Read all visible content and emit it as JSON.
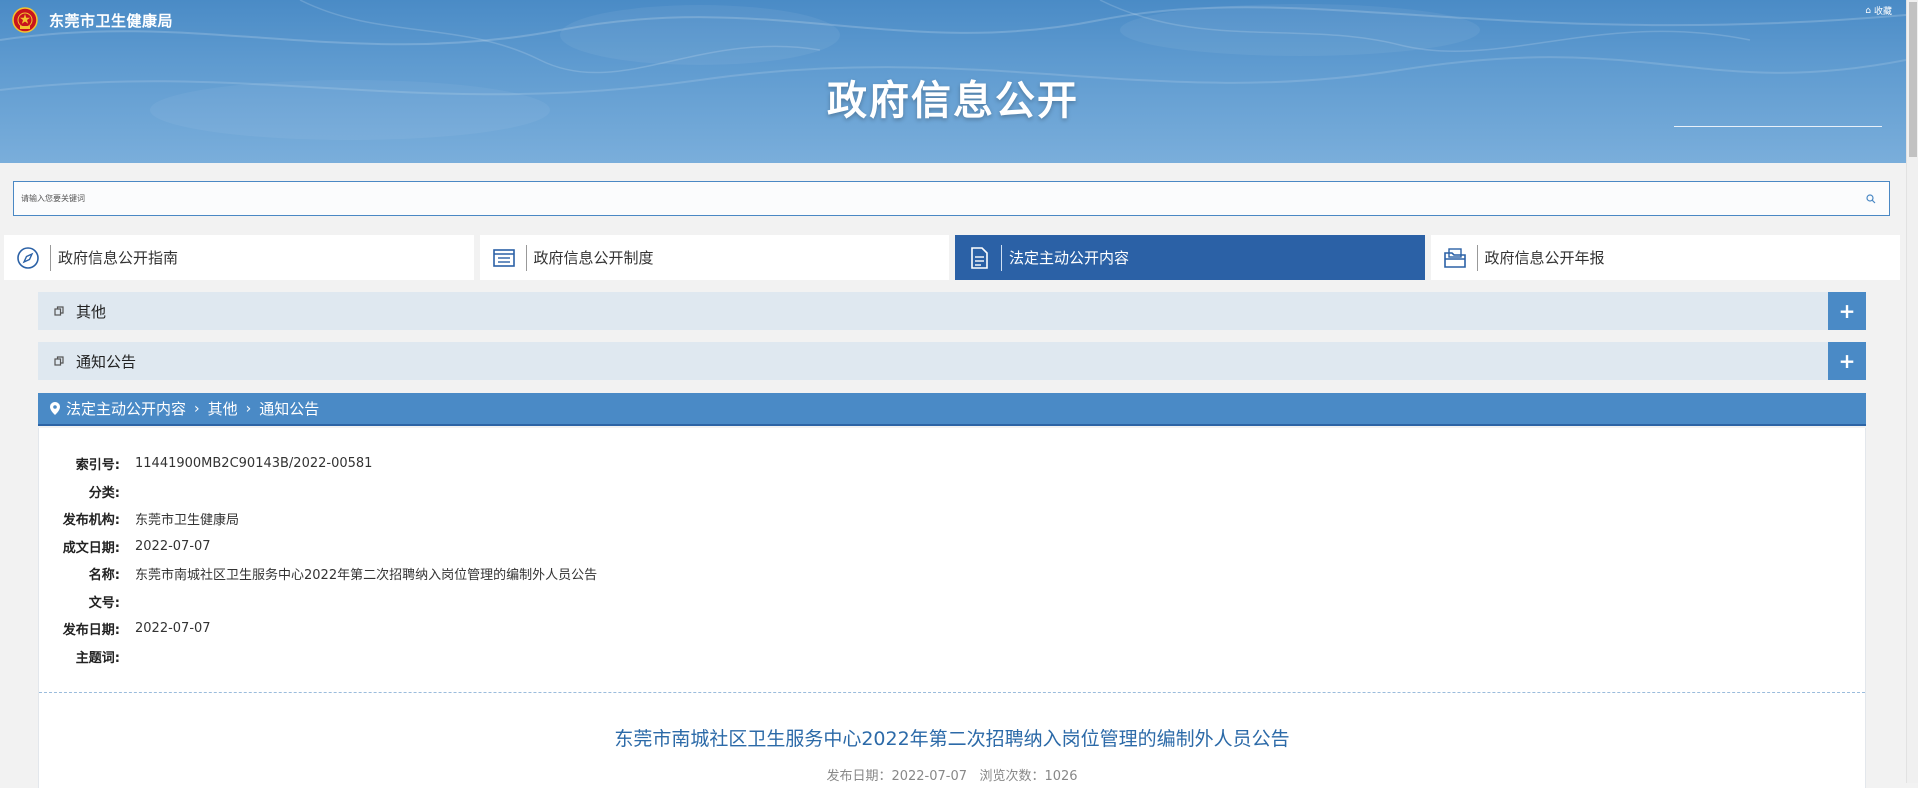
{
  "header": {
    "site_name": "东莞市卫生健康局",
    "title": "政府信息公开",
    "top_link": "收藏",
    "logo_icon": "national-emblem-icon"
  },
  "search": {
    "placeholder": "请输入您要关键词",
    "value": "",
    "icon": "search-icon"
  },
  "tabs": [
    {
      "label": "政府信息公开指南",
      "icon": "compass-icon",
      "active": false
    },
    {
      "label": "政府信息公开制度",
      "icon": "list-icon",
      "active": false
    },
    {
      "label": "法定主动公开内容",
      "icon": "document-icon",
      "active": true
    },
    {
      "label": "政府信息公开年报",
      "icon": "folder-icon",
      "active": false
    }
  ],
  "accordion": [
    {
      "label": "其他",
      "expand_symbol": "+"
    },
    {
      "label": "通知公告",
      "expand_symbol": "+"
    }
  ],
  "breadcrumb": {
    "items": [
      "法定主动公开内容",
      "其他",
      "通知公告"
    ],
    "separator": "›"
  },
  "meta": [
    {
      "key": "索引号:",
      "value": "11441900MB2C90143B/2022-00581"
    },
    {
      "key": "分类:",
      "value": ""
    },
    {
      "key": "发布机构:",
      "value": "东莞市卫生健康局"
    },
    {
      "key": "成文日期:",
      "value": "2022-07-07"
    },
    {
      "key": "名称:",
      "value": "东莞市南城社区卫生服务中心2022年第二次招聘纳入岗位管理的编制外人员公告"
    },
    {
      "key": "文号:",
      "value": ""
    },
    {
      "key": "发布日期:",
      "value": "2022-07-07"
    },
    {
      "key": "主题词:",
      "value": ""
    }
  ],
  "article": {
    "title": "东莞市南城社区卫生服务中心2022年第二次招聘纳入岗位管理的编制外人员公告",
    "publish_label": "发布日期：",
    "publish_date": "2022-07-07",
    "views_label": "浏览次数：",
    "views": "1026"
  },
  "colors": {
    "accent": "#4a8ac6",
    "active_tab": "#2b61a6",
    "title_blue": "#2c6aa8"
  }
}
